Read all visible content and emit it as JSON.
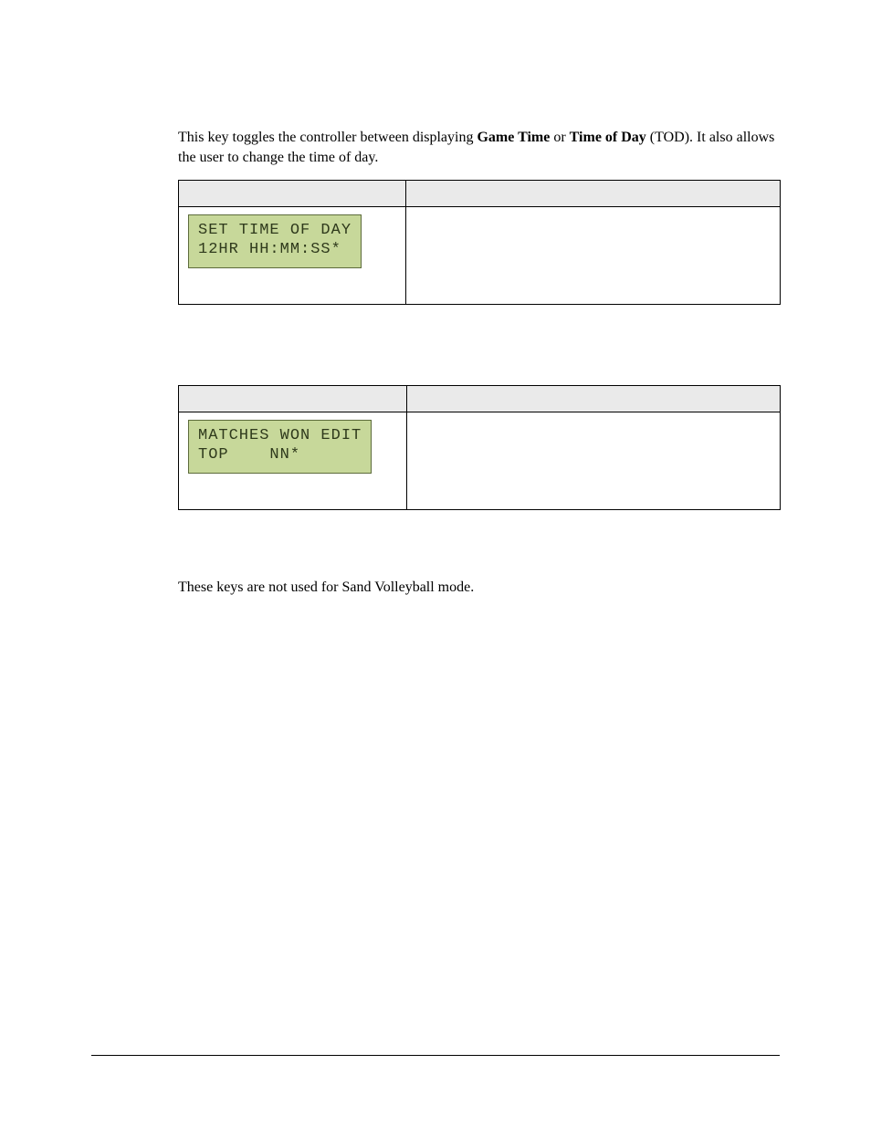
{
  "intro": {
    "prefix": "This key toggles the controller between displaying ",
    "bold1": "Game Time",
    "mid": " or ",
    "bold2": "Time of Day",
    "suffix": " (TOD). It also allows the user to change the time of day."
  },
  "table1": {
    "lcd_line1": "SET TIME OF DAY",
    "lcd_line2": "12HR HH:MM:SS*"
  },
  "table2": {
    "lcd_line1": "MATCHES WON EDIT",
    "lcd_line2": "TOP    NN*"
  },
  "note": "These keys are not used for Sand Volleyball mode."
}
